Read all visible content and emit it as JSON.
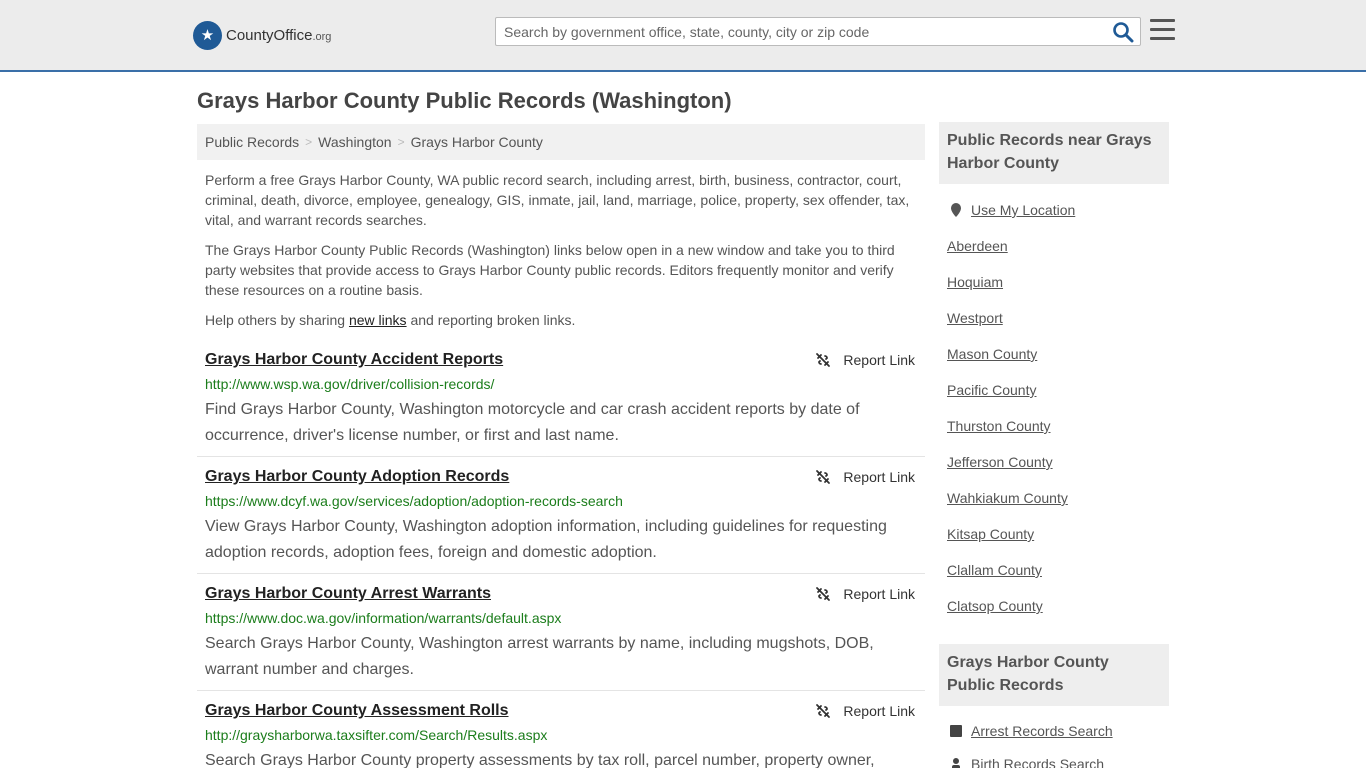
{
  "header": {
    "logo_text_main": "CountyOffice",
    "logo_text_suffix": ".org",
    "search_placeholder": "Search by government office, state, county, city or zip code"
  },
  "page": {
    "title": "Grays Harbor County Public Records (Washington)"
  },
  "breadcrumb": [
    "Public Records",
    "Washington",
    "Grays Harbor County"
  ],
  "intro": {
    "p1": "Perform a free Grays Harbor County, WA public record search, including arrest, birth, business, contractor, court, criminal, death, divorce, employee, genealogy, GIS, inmate, jail, land, marriage, police, property, sex offender, tax, vital, and warrant records searches.",
    "p2": "The Grays Harbor County Public Records (Washington) links below open in a new window and take you to third party websites that provide access to Grays Harbor County public records. Editors frequently monitor and verify these resources on a routine basis.",
    "p3_before": "Help others by sharing ",
    "p3_link": "new links",
    "p3_after": " and reporting broken links."
  },
  "report_label": "Report Link",
  "records": [
    {
      "title": "Grays Harbor County Accident Reports",
      "url": "http://www.wsp.wa.gov/driver/collision-records/",
      "desc": "Find Grays Harbor County, Washington motorcycle and car crash accident reports by date of occurrence, driver's license number, or first and last name."
    },
    {
      "title": "Grays Harbor County Adoption Records",
      "url": "https://www.dcyf.wa.gov/services/adoption/adoption-records-search",
      "desc": "View Grays Harbor County, Washington adoption information, including guidelines for requesting adoption records, adoption fees, foreign and domestic adoption."
    },
    {
      "title": "Grays Harbor County Arrest Warrants",
      "url": "https://www.doc.wa.gov/information/warrants/default.aspx",
      "desc": "Search Grays Harbor County, Washington arrest warrants by name, including mugshots, DOB, warrant number and charges."
    },
    {
      "title": "Grays Harbor County Assessment Rolls",
      "url": "http://graysharborwa.taxsifter.com/Search/Results.aspx",
      "desc": "Search Grays Harbor County property assessments by tax roll, parcel number, property owner,"
    }
  ],
  "sidebar": {
    "nearby_heading": "Public Records near Grays Harbor County",
    "use_location": "Use My Location",
    "nearby": [
      "Aberdeen",
      "Hoquiam",
      "Westport",
      "Mason County",
      "Pacific County",
      "Thurston County",
      "Jefferson County",
      "Wahkiakum County",
      "Kitsap County",
      "Clallam County",
      "Clatsop County"
    ],
    "records_heading": "Grays Harbor County Public Records",
    "record_links": [
      "Arrest Records Search",
      "Birth Records Search"
    ]
  },
  "colors": {
    "brand": "#1f5a96",
    "url_green": "#1b7d1b",
    "header_border": "#3a6fa8"
  }
}
